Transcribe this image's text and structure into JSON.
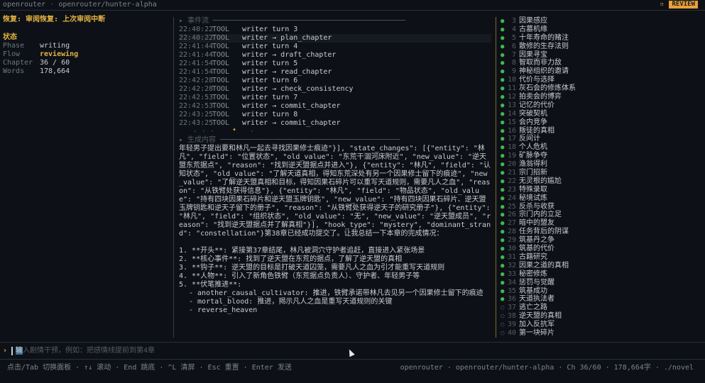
{
  "topbar": {
    "brand": "openrouter",
    "model": "openrouter/hunter-alpha",
    "badge": "REVIEW"
  },
  "left": {
    "resume": "恢复: 审阅恢复: 上次审阅中断",
    "status_title": "状态",
    "fields": [
      {
        "k": "Phase",
        "v": "writing"
      },
      {
        "k": "Flow",
        "v": "reviewing"
      },
      {
        "k": "Chapter",
        "v": "36 / 60"
      },
      {
        "k": "Words",
        "v": "178,664"
      }
    ]
  },
  "events_title": "事件流",
  "events": [
    {
      "time": "22:40:22",
      "type": "TOOL",
      "msg": "writer turn 3"
    },
    {
      "time": "22:40:22",
      "type": "TOOL",
      "msg": "writer → plan_chapter"
    },
    {
      "time": "22:41:44",
      "type": "TOOL",
      "msg": "writer turn 4"
    },
    {
      "time": "22:41:44",
      "type": "TOOL",
      "msg": "writer → draft_chapter"
    },
    {
      "time": "22:41:54",
      "type": "TOOL",
      "msg": "writer turn 5"
    },
    {
      "time": "22:41:54",
      "type": "TOOL",
      "msg": "writer → read_chapter"
    },
    {
      "time": "22:42:28",
      "type": "TOOL",
      "msg": "writer turn 6"
    },
    {
      "time": "22:42:28",
      "type": "TOOL",
      "msg": "writer → check_consistency"
    },
    {
      "time": "22:42:53",
      "type": "TOOL",
      "msg": "writer turn 7"
    },
    {
      "time": "22:42:53",
      "type": "TOOL",
      "msg": "writer → commit_chapter"
    },
    {
      "time": "22:43:25",
      "type": "TOOL",
      "msg": "writer turn 8"
    },
    {
      "time": "22:43:25",
      "type": "TOOL",
      "msg": "writer → commit_chapter"
    }
  ],
  "gen_title": "生成内容",
  "gen_text": "年轻男子提出要和林凡一起去寻找因果修士痕迹\"}], \"state_changes\": [{\"entity\": \"林凡\", \"field\": \"位置状态\", \"old_value\": \"东荒干涸河床附近\", \"new_value\": \"逆天盟东荒据点\", \"reason\": \"找到逆天盟据点并进入\"}, {\"entity\": \"林凡\", \"field\": \"认知状态\", \"old_value\": \"了解天道真相，得知东荒深处有另一个因果修士留下的痕迹\", \"new_value\": \"了解逆天盟真相和目标，得知因果石碎片可以重写天道规则，需要凡人之血\", \"reason\": \"从铁臂处获得信息\"}, {\"entity\": \"林凡\", \"field\": \"物品状态\", \"old_value\": \"持有四块因果石碎片和逆天盟玉牌钥匙\", \"new_value\": \"持有四块因果石碎片、逆天盟玉牌钥匙和逆天子留下的册子\", \"reason\": \"从铁臂处获得逆天子的研究册子\"}, {\"entity\": \"林凡\", \"field\": \"组织状态\", \"old_value\": \"无\", \"new_value\": \"逆天盟成员\", \"reason\": \"找到逆天盟据点并了解真相\"}], \"hook_type\": \"mystery\", \"dominant_strand\": \"constellation\"}第38章已经成功提交了。让我总结一下本章的完成情况：",
  "gen_list": [
    "1. **开头**: 紧接第37章结尾，林凡被洞穴守护者追赶，直接进入紧张场景",
    "2. **核心事件**: 找到了逆天盟在东荒的据点，了解了逆天盟的真相",
    "3. **钩子**: 逆天盟的目标是打破天道囚笼，需要凡人之血为引才能重写天道规则",
    "4. **人物**: 引入了新角色铁臂（东荒据点负责人）、守护者、年轻男子等",
    "5. **伏笔推进**:"
  ],
  "gen_sub": [
    "- another_causal_cultivator: 推进，铁臂承诺带林凡去见另一个因果修士留下的痕迹",
    "- mortal_blood: 推进，揭示凡人之血是重写天道规则的关键",
    "- reverse_heaven"
  ],
  "chapters": [
    {
      "n": "3",
      "t": "因果感应",
      "done": true
    },
    {
      "n": "4",
      "t": "古墓机缘",
      "done": true
    },
    {
      "n": "5",
      "t": "十年寿命的赌注",
      "done": true
    },
    {
      "n": "6",
      "t": "散修的生存法则",
      "done": true
    },
    {
      "n": "7",
      "t": "因果寻宝",
      "done": true
    },
    {
      "n": "8",
      "t": "智取而非力敌",
      "done": true
    },
    {
      "n": "9",
      "t": "神秘组织的邀请",
      "done": true
    },
    {
      "n": "10",
      "t": "代价与选择",
      "done": true
    },
    {
      "n": "11",
      "t": "灰石会的修炼体系",
      "done": true
    },
    {
      "n": "12",
      "t": "拍卖会的博弈",
      "done": true
    },
    {
      "n": "13",
      "t": "记忆的代价",
      "done": true
    },
    {
      "n": "14",
      "t": "突破契机",
      "done": true
    },
    {
      "n": "15",
      "t": "会内竞争",
      "done": true
    },
    {
      "n": "16",
      "t": "叛徒的真相",
      "done": true
    },
    {
      "n": "17",
      "t": "反间计",
      "done": true
    },
    {
      "n": "18",
      "t": "个人危机",
      "done": true
    },
    {
      "n": "19",
      "t": "矿脉争夺",
      "done": true
    },
    {
      "n": "20",
      "t": "渔翁得利",
      "done": true
    },
    {
      "n": "21",
      "t": "宗门招新",
      "done": true
    },
    {
      "n": "22",
      "t": "无灵根的尴尬",
      "done": true
    },
    {
      "n": "23",
      "t": "特殊录取",
      "done": true
    },
    {
      "n": "24",
      "t": "秘境试炼",
      "done": true
    },
    {
      "n": "25",
      "t": "反杀与收获",
      "done": true
    },
    {
      "n": "26",
      "t": "宗门内的立足",
      "done": true
    },
    {
      "n": "27",
      "t": "暗中的盟友",
      "done": true
    },
    {
      "n": "28",
      "t": "任务背后的阴谋",
      "done": true
    },
    {
      "n": "29",
      "t": "筑基丹之争",
      "done": true
    },
    {
      "n": "30",
      "t": "筑基的代价",
      "done": true
    },
    {
      "n": "31",
      "t": "古籍研究",
      "done": true
    },
    {
      "n": "32",
      "t": "因果之道的真相",
      "done": true
    },
    {
      "n": "33",
      "t": "秘密修炼",
      "done": true
    },
    {
      "n": "34",
      "t": "惩罚与觉醒",
      "done": true
    },
    {
      "n": "35",
      "t": "筑基成功",
      "done": true
    },
    {
      "n": "36",
      "t": "天道执法者",
      "done": true
    },
    {
      "n": "37",
      "t": "逃亡之路",
      "done": false
    },
    {
      "n": "38",
      "t": "逆天盟的真相",
      "done": false
    },
    {
      "n": "39",
      "t": "加入反抗军",
      "done": false
    },
    {
      "n": "40",
      "t": "第一块碎片",
      "done": false
    }
  ],
  "input": {
    "prompt": "›",
    "placeholder_first": "输",
    "placeholder": "入剧情干预，例如：把感情线提前到第4章"
  },
  "hints": "点击/Tab 切换面板 · ↑↓ 滚动 · End 跳底 · ^L 清屏 · Esc 重置 · Enter 发送",
  "status_right": "openrouter · openrouter/hunter-alpha · Ch 36/60 · 178,664字 · ./novel"
}
